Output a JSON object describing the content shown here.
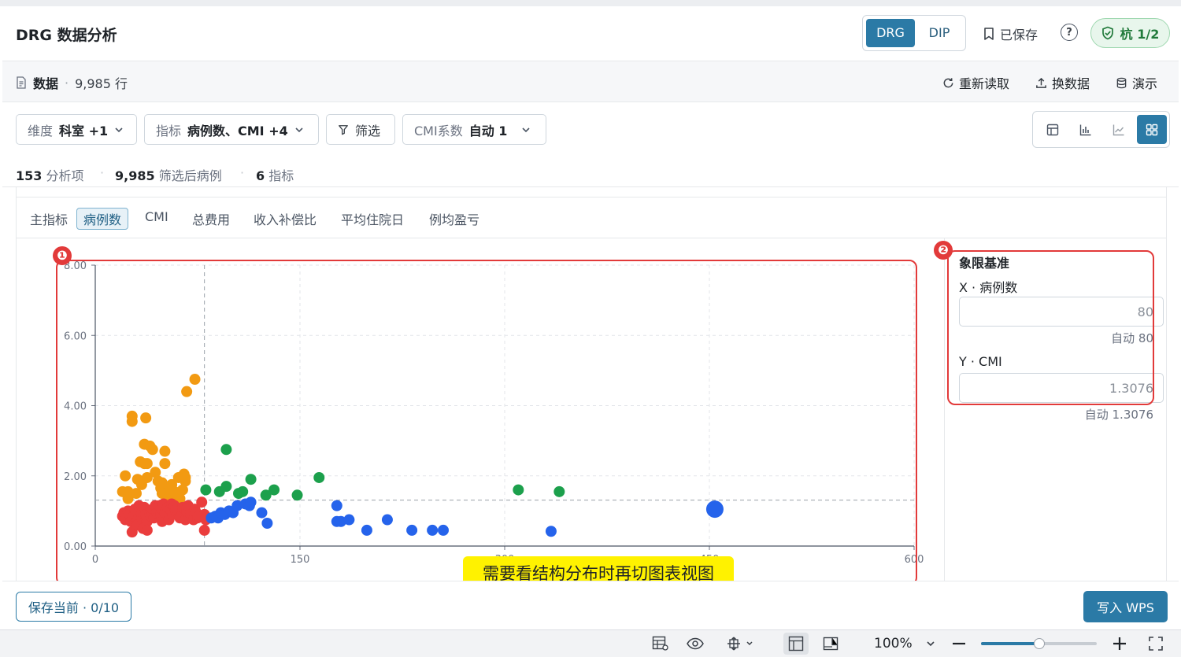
{
  "header": {
    "title": "DRG 数据分析",
    "mode_options": [
      "DRG",
      "DIP"
    ],
    "saved_label": "已保存",
    "help_label": "?",
    "badge_label": "杭 1/2"
  },
  "subheader": {
    "data_label": "数据",
    "row_count": "9,985 行",
    "actions": [
      "重新读取",
      "换数据",
      "演示"
    ]
  },
  "filters": {
    "dimension": {
      "label": "维度",
      "value": "科室 +1"
    },
    "metric": {
      "label": "指标",
      "value": "病例数、CMI +4"
    },
    "filter_label": "筛选",
    "cmi": {
      "label": "CMI系数",
      "value": "自动 1"
    }
  },
  "stats": {
    "items_count": "153",
    "items_label": "分析项",
    "cases_count": "9,985",
    "cases_label": "筛选后病例",
    "metrics_count": "6",
    "metrics_label": "指标"
  },
  "tabs": [
    "主指标",
    "病例数",
    "CMI",
    "总费用",
    "收入补偿比",
    "平均住院日",
    "例均盈亏"
  ],
  "active_tab": "病例数",
  "quadrant": {
    "title": "象限基准",
    "x_label": "X · 病例数",
    "x_value": "80",
    "x_hint": "自动 80",
    "y_label": "Y · CMI",
    "y_value": "1.3076",
    "y_hint": "自动 1.3076"
  },
  "annotations": {
    "badge1": "❶",
    "badge2": "❷",
    "callout": "需要看结构分布时再切图表视图"
  },
  "footer": {
    "save_current": "保存当前 · 0/10",
    "write_wps": "写入 WPS"
  },
  "statusbar": {
    "zoom": "100%",
    "zoom_fraction": 0.5
  },
  "colors": {
    "accent": "#2b7aa6",
    "orange": "#f29a12",
    "red": "#ea3d3d",
    "green": "#1ca04c",
    "blue": "#2563eb"
  },
  "chart_data": {
    "type": "scatter",
    "title": "",
    "xlabel": "",
    "ylabel": "",
    "xlim": [
      0,
      600
    ],
    "ylim": [
      0,
      8
    ],
    "x_ticks": [
      "0",
      "150",
      "300",
      "450",
      "600"
    ],
    "y_ticks": [
      "0.00",
      "2.00",
      "4.00",
      "6.00",
      "8.00"
    ],
    "x_tick_values": [
      0,
      150,
      300,
      450,
      600
    ],
    "y_tick_values": [
      0,
      2,
      4,
      6,
      8
    ],
    "reference_x": 80,
    "reference_y": 1.3076,
    "grid": true,
    "series": [
      {
        "color": "#f29a12",
        "points": [
          [
            20,
            1.55
          ],
          [
            22,
            2.0
          ],
          [
            24,
            1.35
          ],
          [
            24,
            1.55
          ],
          [
            27,
            3.55
          ],
          [
            27,
            3.7
          ],
          [
            30,
            1.5
          ],
          [
            31,
            1.9
          ],
          [
            33,
            2.4
          ],
          [
            34,
            1.75
          ],
          [
            36,
            2.35
          ],
          [
            36,
            2.9
          ],
          [
            37,
            3.65
          ],
          [
            38,
            2.35
          ],
          [
            38,
            1.95
          ],
          [
            40,
            2.85
          ],
          [
            42,
            2.75
          ],
          [
            44,
            2.1
          ],
          [
            46,
            1.85
          ],
          [
            48,
            1.65
          ],
          [
            49,
            1.5
          ],
          [
            49,
            1.8
          ],
          [
            51,
            2.35
          ],
          [
            51,
            2.7
          ],
          [
            54,
            1.4
          ],
          [
            55,
            1.65
          ],
          [
            56,
            1.75
          ],
          [
            58,
            1.55
          ],
          [
            60,
            1.45
          ],
          [
            61,
            1.95
          ],
          [
            62,
            1.35
          ],
          [
            64,
            1.6
          ],
          [
            65,
            2.05
          ],
          [
            66,
            1.85
          ],
          [
            66,
            1.95
          ],
          [
            67,
            4.4
          ],
          [
            73,
            4.75
          ]
        ]
      },
      {
        "color": "#ea3d3d",
        "points": [
          [
            20,
            0.85
          ],
          [
            21,
            0.95
          ],
          [
            22,
            0.75
          ],
          [
            24,
            1.0
          ],
          [
            25,
            0.9
          ],
          [
            26,
            0.7
          ],
          [
            27,
            0.4
          ],
          [
            28,
            0.85
          ],
          [
            29,
            1.05
          ],
          [
            30,
            0.9
          ],
          [
            31,
            0.75
          ],
          [
            31,
            0.6
          ],
          [
            32,
            1.15
          ],
          [
            33,
            1.0
          ],
          [
            34,
            0.8
          ],
          [
            34,
            0.95
          ],
          [
            35,
            0.5
          ],
          [
            36,
            1.1
          ],
          [
            37,
            0.9
          ],
          [
            38,
            0.7
          ],
          [
            38,
            0.45
          ],
          [
            40,
            0.95
          ],
          [
            41,
            0.85
          ],
          [
            42,
            1.05
          ],
          [
            43,
            0.8
          ],
          [
            44,
            1.15
          ],
          [
            45,
            0.95
          ],
          [
            46,
            1.0
          ],
          [
            47,
            1.15
          ],
          [
            48,
            0.9
          ],
          [
            49,
            1.05
          ],
          [
            49,
            0.7
          ],
          [
            50,
            1.2
          ],
          [
            51,
            0.95
          ],
          [
            53,
            1.1
          ],
          [
            54,
            0.75
          ],
          [
            55,
            1.05
          ],
          [
            56,
            1.2
          ],
          [
            57,
            0.9
          ],
          [
            58,
            1.15
          ],
          [
            59,
            1.0
          ],
          [
            60,
            1.05
          ],
          [
            62,
            0.8
          ],
          [
            63,
            0.85
          ],
          [
            64,
            1.1
          ],
          [
            66,
            0.75
          ],
          [
            67,
            1.0
          ],
          [
            68,
            1.15
          ],
          [
            69,
            0.8
          ],
          [
            70,
            0.9
          ],
          [
            72,
            0.75
          ],
          [
            73,
            1.05
          ],
          [
            74,
            0.95
          ],
          [
            75,
            0.8
          ],
          [
            76,
            0.85
          ],
          [
            78,
            1.25
          ],
          [
            80,
            0.9
          ],
          [
            80,
            0.45
          ],
          [
            81,
            0.75
          ],
          [
            79,
            0.85
          ]
        ]
      },
      {
        "color": "#1ca04c",
        "points": [
          [
            81,
            1.6
          ],
          [
            91,
            1.55
          ],
          [
            96,
            1.7
          ],
          [
            96,
            2.75
          ],
          [
            105,
            1.5
          ],
          [
            108,
            1.55
          ],
          [
            114,
            1.9
          ],
          [
            125,
            1.45
          ],
          [
            131,
            1.6
          ],
          [
            148,
            1.45
          ],
          [
            164,
            1.95
          ],
          [
            310,
            1.6
          ],
          [
            340,
            1.55
          ]
        ]
      },
      {
        "color": "#2563eb",
        "points": [
          [
            85,
            0.8
          ],
          [
            88,
            0.85
          ],
          [
            90,
            0.8
          ],
          [
            92,
            0.95
          ],
          [
            95,
            0.9
          ],
          [
            98,
            1.0
          ],
          [
            101,
            0.95
          ],
          [
            104,
            1.15
          ],
          [
            110,
            1.2
          ],
          [
            113,
            1.15
          ],
          [
            114,
            1.25
          ],
          [
            122,
            0.95
          ],
          [
            126,
            0.65
          ],
          [
            177,
            1.15
          ],
          [
            177,
            0.7
          ],
          [
            180,
            0.7
          ],
          [
            186,
            0.75
          ],
          [
            199,
            0.45
          ],
          [
            214,
            0.75
          ],
          [
            232,
            0.45
          ],
          [
            247,
            0.45
          ],
          [
            255,
            0.45
          ],
          [
            334,
            0.42
          ]
        ]
      },
      {
        "color": "#2563eb",
        "large": true,
        "points": [
          [
            454,
            1.05
          ]
        ]
      }
    ]
  }
}
